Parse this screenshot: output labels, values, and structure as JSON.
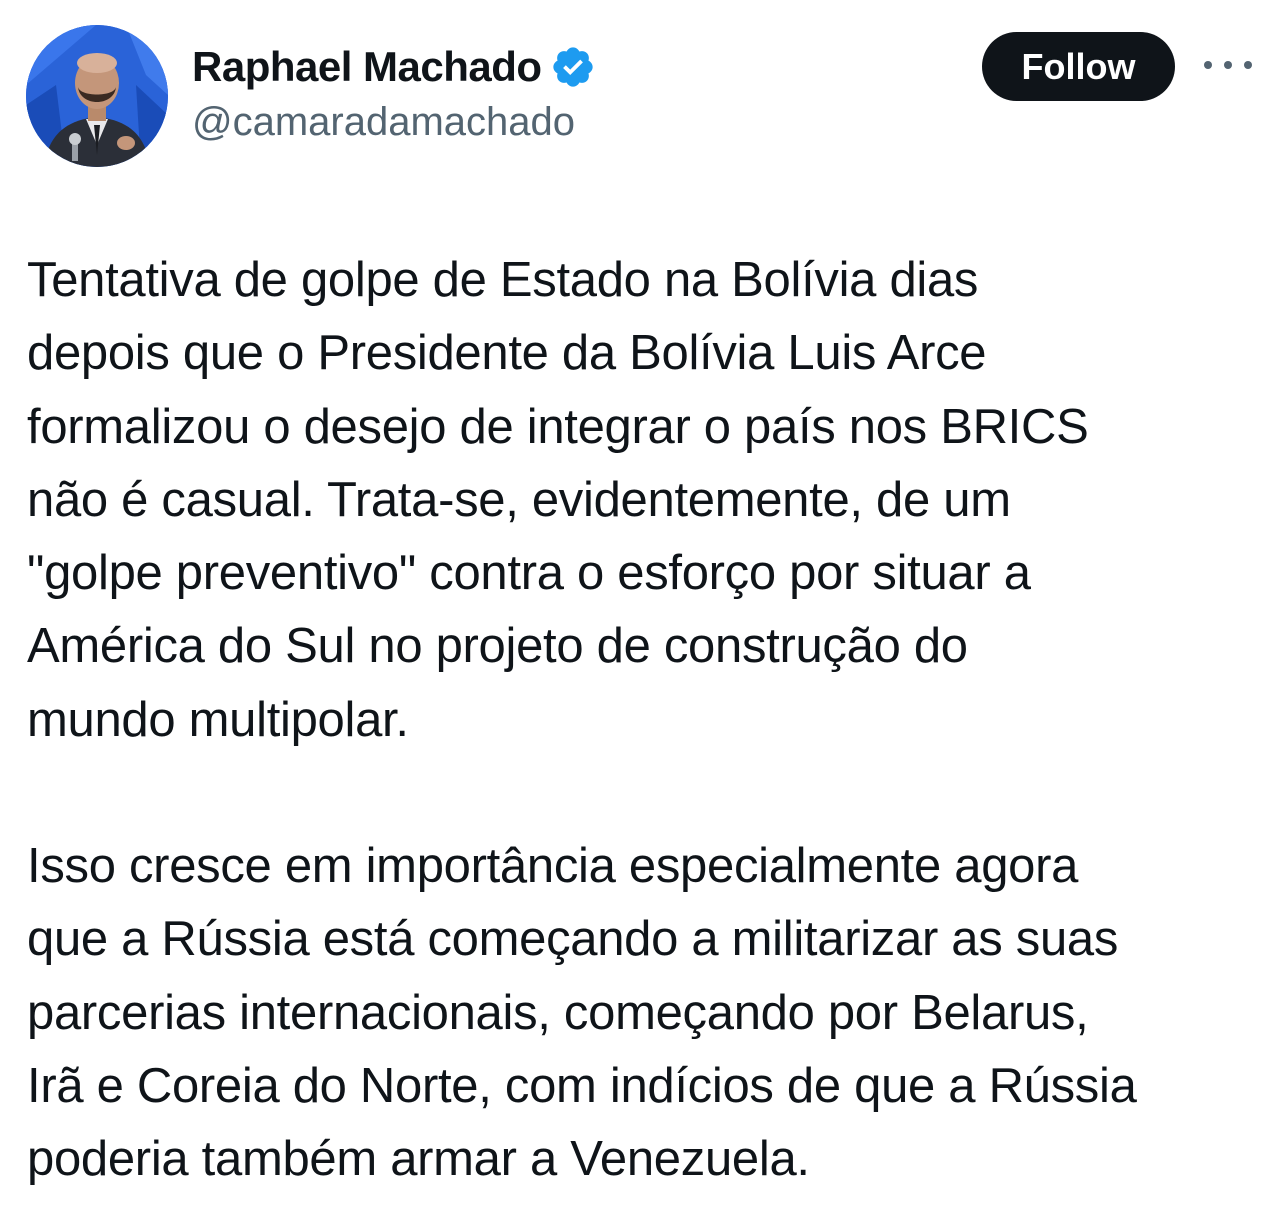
{
  "author": {
    "display_name": "Raphael Machado",
    "handle": "@camaradamachado",
    "verified": true,
    "verified_color": "#1d9bf0"
  },
  "actions": {
    "follow_label": "Follow",
    "more_icon": "more-horizontal-icon"
  },
  "tweet": {
    "paragraphs": [
      "Tentativa de golpe de Estado na Bolívia dias\ndepois que o Presidente da Bolívia Luis Arce\nformalizou o desejo de integrar o país nos BRICS\nnão é casual. Trata-se, evidentemente, de um\n\"golpe preventivo\" contra o esforço por situar a\nAmérica do Sul no projeto de construção do\nmundo multipolar.",
      "Isso cresce em importância especialmente agora\nque a Rússia está começando a militarizar as suas\nparcerias internacionais, começando por Belarus,\nIrã e Coreia do Norte, com indícios de que a Rússia\npoderia também armar a Venezuela."
    ]
  },
  "colors": {
    "text": "#0f1419",
    "secondary_text": "#536471",
    "button_bg": "#0f1419",
    "button_text": "#ffffff",
    "avatar_bg": "#1f5fd6"
  }
}
